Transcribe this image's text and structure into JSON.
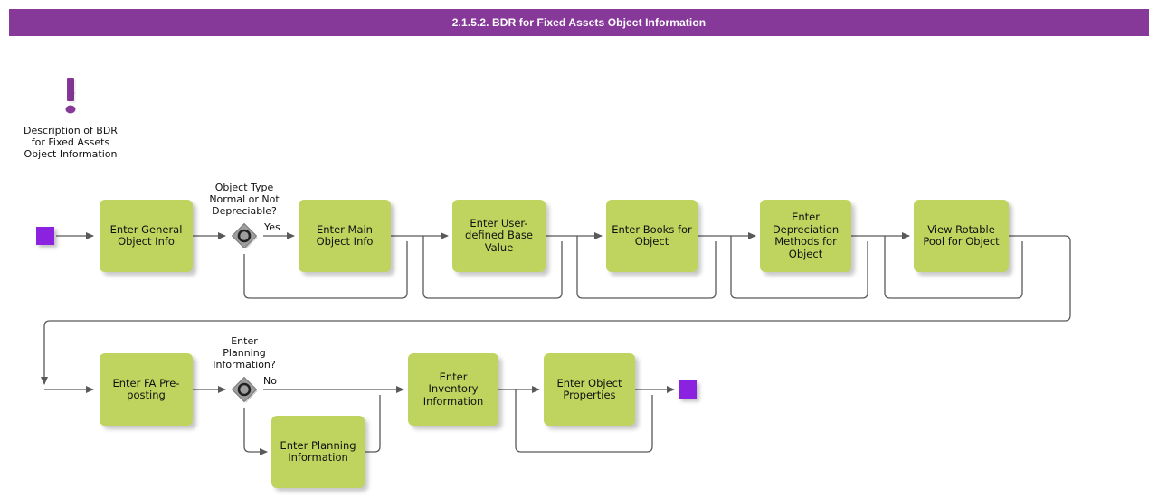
{
  "title": {
    "text": "2.1.5.2. BDR for Fixed Assets Object Information",
    "bar_color": "#87399a",
    "text_color": "#ffffff"
  },
  "annotation": {
    "icon": "exclamation-mark-icon",
    "icon_color": "#87399a",
    "text": "Description of BDR\nfor Fixed Assets\nObject Information"
  },
  "palette": {
    "task_fill": "#bed45e",
    "event_fill": "#8a22e0",
    "gateway_fill": "#9e9e9e",
    "gateway_ring": "#333333",
    "connector": "#595959"
  },
  "events": [
    {
      "id": "start",
      "name": "start-event",
      "type": "start"
    },
    {
      "id": "end",
      "name": "end-event",
      "type": "end"
    }
  ],
  "tasks": [
    {
      "id": "t1",
      "label": "Enter General\nObject Info"
    },
    {
      "id": "t2",
      "label": "Enter Main\nObject Info"
    },
    {
      "id": "t3",
      "label": "Enter User-\ndefined Base\nValue"
    },
    {
      "id": "t4",
      "label": "Enter Books for\nObject"
    },
    {
      "id": "t5",
      "label": "Enter\nDepreciation\nMethods for\nObject"
    },
    {
      "id": "t6",
      "label": "View Rotable\nPool for Object"
    },
    {
      "id": "t7",
      "label": "Enter FA Pre-\nposting"
    },
    {
      "id": "t8",
      "label": "Enter Planning\nInformation"
    },
    {
      "id": "t9",
      "label": "Enter Inventory\nInformation"
    },
    {
      "id": "t10",
      "label": "Enter Object\nProperties"
    }
  ],
  "gateways": [
    {
      "id": "g1",
      "label": "Object Type\nNormal or Not\nDepreciable?",
      "type": "inclusive",
      "outgoing_label": "Yes"
    },
    {
      "id": "g2",
      "label": "Enter\nPlanning\nInformation?",
      "type": "inclusive",
      "outgoing_label": "No"
    }
  ]
}
